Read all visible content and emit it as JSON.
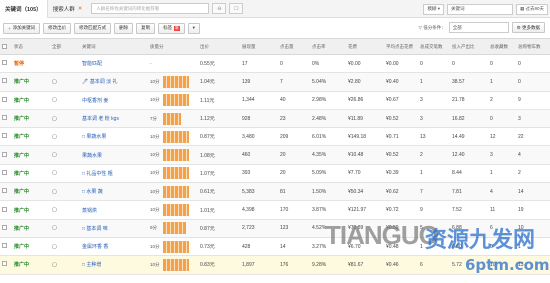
{
  "tabs": {
    "keywords_tab": "关键词（105）",
    "search_crowd_tab": "搜索人群",
    "close_mark": "✕",
    "search_placeholder": "人群名称找关键词的转化推荐看",
    "mini_btn_1": "⊖",
    "mini_btn_2": "☐"
  },
  "topright": {
    "mode_select": "模糊",
    "keyword_input_placeholder": "关键词",
    "date_icon": "▦",
    "date_range": "过去90天"
  },
  "toolbar": {
    "add_keyword": "添加关键词",
    "modify_bid": "修改出价",
    "modify_match": "修改匹配方式",
    "delete": "删除",
    "copy": "复制",
    "tag": "标签",
    "tag_badge": "新",
    "more_label": "▾",
    "filter_label": "▽ 低分条件：",
    "filter_value": "全部",
    "more_data": "⚙ 更多数据"
  },
  "columns": [
    "",
    "状态",
    "全部",
    "关键词",
    "质量分",
    "出价",
    "展现量",
    "点击量",
    "点击率",
    "花费",
    "平均点击花费",
    "总成交笔数",
    "投入产出比",
    "总收藏数",
    "总购物车数"
  ],
  "rows": [
    {
      "status": "暂停",
      "pending": true,
      "all": "",
      "kw": "智能匹配",
      "mobile": false,
      "quality": "-",
      "bar": 0,
      "bid": "0.55元",
      "impr": "17",
      "click": "0",
      "ctr": "0%",
      "cost": "¥0.00",
      "cpc": "¥0.00",
      "orders": "0",
      "roi": "0",
      "fav": "0",
      "cart": "0"
    },
    {
      "status": "推广中",
      "pending": false,
      "all": "▢",
      "kw": "🖊 基本调 淡 礼",
      "mobile": true,
      "quality": "10分",
      "bar": 10,
      "bid": "1.04元",
      "impr": "139",
      "click": "7",
      "ctr": "5.04%",
      "cost": "¥2.80",
      "cpc": "¥0.40",
      "orders": "1",
      "roi": "38.57",
      "fav": "1",
      "cart": "0"
    },
    {
      "status": "推广中",
      "pending": false,
      "all": "▢",
      "kw": "中枢香剂 姜",
      "mobile": true,
      "quality": "10分",
      "bar": 10,
      "bid": "1.11元",
      "impr": "1,344",
      "click": "40",
      "ctr": "2.98%",
      "cost": "¥26.86",
      "cpc": "¥0.67",
      "orders": "3",
      "roi": "21.78",
      "fav": "2",
      "cart": "9"
    },
    {
      "status": "推广中",
      "pending": false,
      "all": "▢",
      "kw": "基本调 老 粉 kgs",
      "mobile": true,
      "quality": "7分",
      "bar": 7,
      "bid": "1.12元",
      "impr": "928",
      "click": "23",
      "ctr": "2.48%",
      "cost": "¥11.89",
      "cpc": "¥0.52",
      "orders": "3",
      "roi": "16.82",
      "fav": "0",
      "cart": "3"
    },
    {
      "status": "推广中",
      "pending": false,
      "all": "▢",
      "kw": "□ 果蔬水果",
      "mobile": true,
      "quality": "10分",
      "bar": 10,
      "bid": "0.87元",
      "impr": "3,480",
      "click": "209",
      "ctr": "6.01%",
      "cost": "¥149.18",
      "cpc": "¥0.71",
      "orders": "13",
      "roi": "14.49",
      "fav": "12",
      "cart": "22"
    },
    {
      "status": "推广中",
      "pending": false,
      "all": "▢",
      "kw": "果蔬水果",
      "mobile": true,
      "quality": "10分",
      "bar": 10,
      "bid": "1.08元",
      "impr": "460",
      "click": "20",
      "ctr": "4.35%",
      "cost": "¥10.48",
      "cpc": "¥0.52",
      "orders": "2",
      "roi": "12.40",
      "fav": "3",
      "cart": "4"
    },
    {
      "status": "推广中",
      "pending": false,
      "all": "▢",
      "kw": "□ 礼品中性 粗",
      "mobile": true,
      "quality": "10分",
      "bar": 10,
      "bid": "1.07元",
      "impr": "393",
      "click": "20",
      "ctr": "5.09%",
      "cost": "¥7.70",
      "cpc": "¥0.39",
      "orders": "1",
      "roi": "8.44",
      "fav": "1",
      "cart": "2"
    },
    {
      "status": "推广中",
      "pending": false,
      "all": "▢",
      "kw": "□ 水果 蔬",
      "mobile": true,
      "quality": "10分",
      "bar": 10,
      "bid": "0.61元",
      "impr": "5,383",
      "click": "81",
      "ctr": "1.50%",
      "cost": "¥50.34",
      "cpc": "¥0.62",
      "orders": "7",
      "roi": "7.81",
      "fav": "4",
      "cart": "14"
    },
    {
      "status": "推广中",
      "pending": false,
      "all": "▢",
      "kw": "蒸锅烘",
      "mobile": true,
      "quality": "10分",
      "bar": 10,
      "bid": "1.01元",
      "impr": "4,398",
      "click": "170",
      "ctr": "3.87%",
      "cost": "¥121.97",
      "cpc": "¥0.72",
      "orders": "9",
      "roi": "7.52",
      "fav": "11",
      "cart": "19"
    },
    {
      "status": "推广中",
      "pending": false,
      "all": "▢",
      "kw": "□ 基本调 味",
      "mobile": true,
      "quality": "9分",
      "bar": 9,
      "bid": "0.87元",
      "impr": "2,723",
      "click": "123",
      "ctr": "4.52%",
      "cost": "¥72.89",
      "cpc": "¥0.59",
      "orders": "5",
      "roi": "6.88",
      "fav": "6",
      "cart": "10"
    },
    {
      "status": "推广中",
      "pending": false,
      "all": "▢",
      "kw": "金属环香 香",
      "mobile": true,
      "quality": "10分",
      "bar": 10,
      "bid": "0.73元",
      "impr": "428",
      "click": "14",
      "ctr": "3.27%",
      "cost": "¥6.70",
      "cpc": "¥0.48",
      "orders": "1",
      "roi": "6.60",
      "fav": "0",
      "cart": "1"
    },
    {
      "status": "推广中",
      "pending": false,
      "all": "▢",
      "kw": "□ 主种增",
      "mobile": true,
      "quality": "10分",
      "bar": 10,
      "bid": "0.83元",
      "impr": "1,897",
      "click": "176",
      "ctr": "9.28%",
      "cost": "¥81.67",
      "cpc": "¥0.46",
      "orders": "6",
      "roi": "5.72",
      "fav": "10",
      "cart": "13"
    }
  ],
  "watermark": {
    "brand_latin": "TIANGUO",
    "brand_cn": "资源九发网",
    "site": "6ptm.com"
  }
}
